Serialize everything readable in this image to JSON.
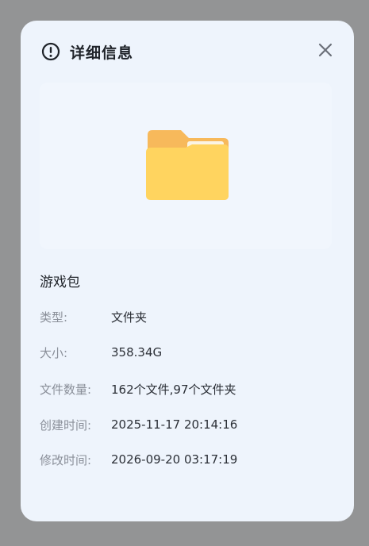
{
  "dialog": {
    "title": "详细信息",
    "icon": "info-circle-icon",
    "close_icon": "close-icon"
  },
  "preview": {
    "icon": "folder-icon",
    "colors": {
      "folder_back": "#f7b95b",
      "folder_front": "#ffd45f",
      "paper": "#fbf4e4"
    }
  },
  "item": {
    "name": "游戏包"
  },
  "details": [
    {
      "label": "类型:",
      "value": "文件夹"
    },
    {
      "label": "大小:",
      "value": "358.34G"
    },
    {
      "label": "文件数量:",
      "value": "162个文件,97个文件夹"
    },
    {
      "label": "创建时间:",
      "value": "2025-11-17 20:14:16"
    },
    {
      "label": "修改时间:",
      "value": "2026-09-20 03:17:19"
    }
  ]
}
